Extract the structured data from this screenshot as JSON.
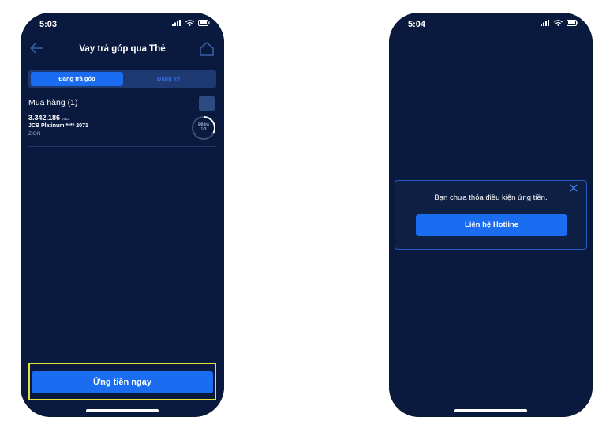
{
  "left_screen": {
    "status_time": "5:03",
    "nav_title": "Vay trả góp qua Thẻ",
    "tabs": [
      {
        "label": "Đang trả góp",
        "active": true
      },
      {
        "label": "Đăng ký",
        "active": false
      }
    ],
    "section_title": "Mua hàng (1)",
    "items": [
      {
        "amount": "3.342.186",
        "currency": "VND",
        "card": "JCB Platinum **** 2071",
        "merchant": "ZION",
        "progress_label": "Đã trả",
        "progress_value": "1/3",
        "progress_fraction": 0.3333
      }
    ],
    "primary_button": "Ứng tiền ngay"
  },
  "right_screen": {
    "status_time": "5:04",
    "dialog_message": "Bạn chưa thỏa điều kiện ứng tiền.",
    "dialog_button": "Liên hệ Hotline"
  },
  "colors": {
    "background": "#0a1a3e",
    "accent": "#1a6cf0",
    "highlight": "#e4e23a"
  }
}
